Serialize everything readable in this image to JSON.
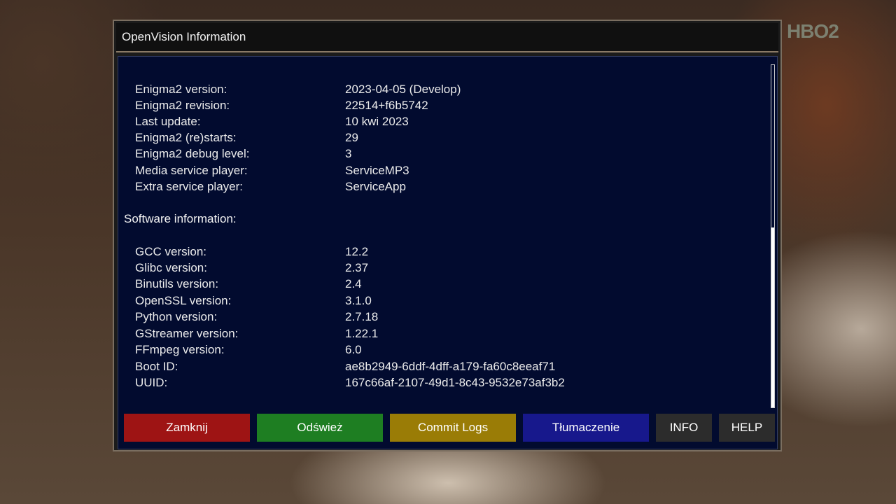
{
  "channel_logo": "HBO2",
  "window": {
    "title": "OpenVision Information"
  },
  "enigma_info": [
    {
      "label": "Enigma2 version:",
      "value": "2023-04-05 (Develop)"
    },
    {
      "label": "Enigma2 revision:",
      "value": "22514+f6b5742"
    },
    {
      "label": "Last update:",
      "value": "10 kwi 2023"
    },
    {
      "label": "Enigma2 (re)starts:",
      "value": "29"
    },
    {
      "label": "Enigma2 debug level:",
      "value": "3"
    },
    {
      "label": "Media service player:",
      "value": "ServiceMP3"
    },
    {
      "label": "Extra service player:",
      "value": "ServiceApp"
    }
  ],
  "software_section": {
    "heading": "Software information:"
  },
  "software_info": [
    {
      "label": "GCC version:",
      "value": "12.2"
    },
    {
      "label": "Glibc version:",
      "value": "2.37"
    },
    {
      "label": "Binutils version:",
      "value": "2.4"
    },
    {
      "label": "OpenSSL version:",
      "value": "3.1.0"
    },
    {
      "label": "Python version:",
      "value": "2.7.18"
    },
    {
      "label": "GStreamer version:",
      "value": "1.22.1"
    },
    {
      "label": "FFmpeg version:",
      "value": "6.0"
    },
    {
      "label": "Boot ID:",
      "value": "ae8b2949-6ddf-4dff-a179-fa60c8eeaf71"
    },
    {
      "label": "UUID:",
      "value": "167c66af-2107-49d1-8c43-9532e73af3b2"
    }
  ],
  "buttons": {
    "red": "Zamknij",
    "green": "Odśwież",
    "yellow": "Commit Logs",
    "blue": "Tłumaczenie",
    "info": "INFO",
    "help": "HELP"
  },
  "colors": {
    "red": "#9e1414",
    "green": "#1e7e22",
    "yellow": "#9a7c06",
    "blue": "#17188c",
    "panel": "#020b2f"
  },
  "scroll": {
    "position_fraction": 0.47,
    "visible_fraction": 0.53
  }
}
